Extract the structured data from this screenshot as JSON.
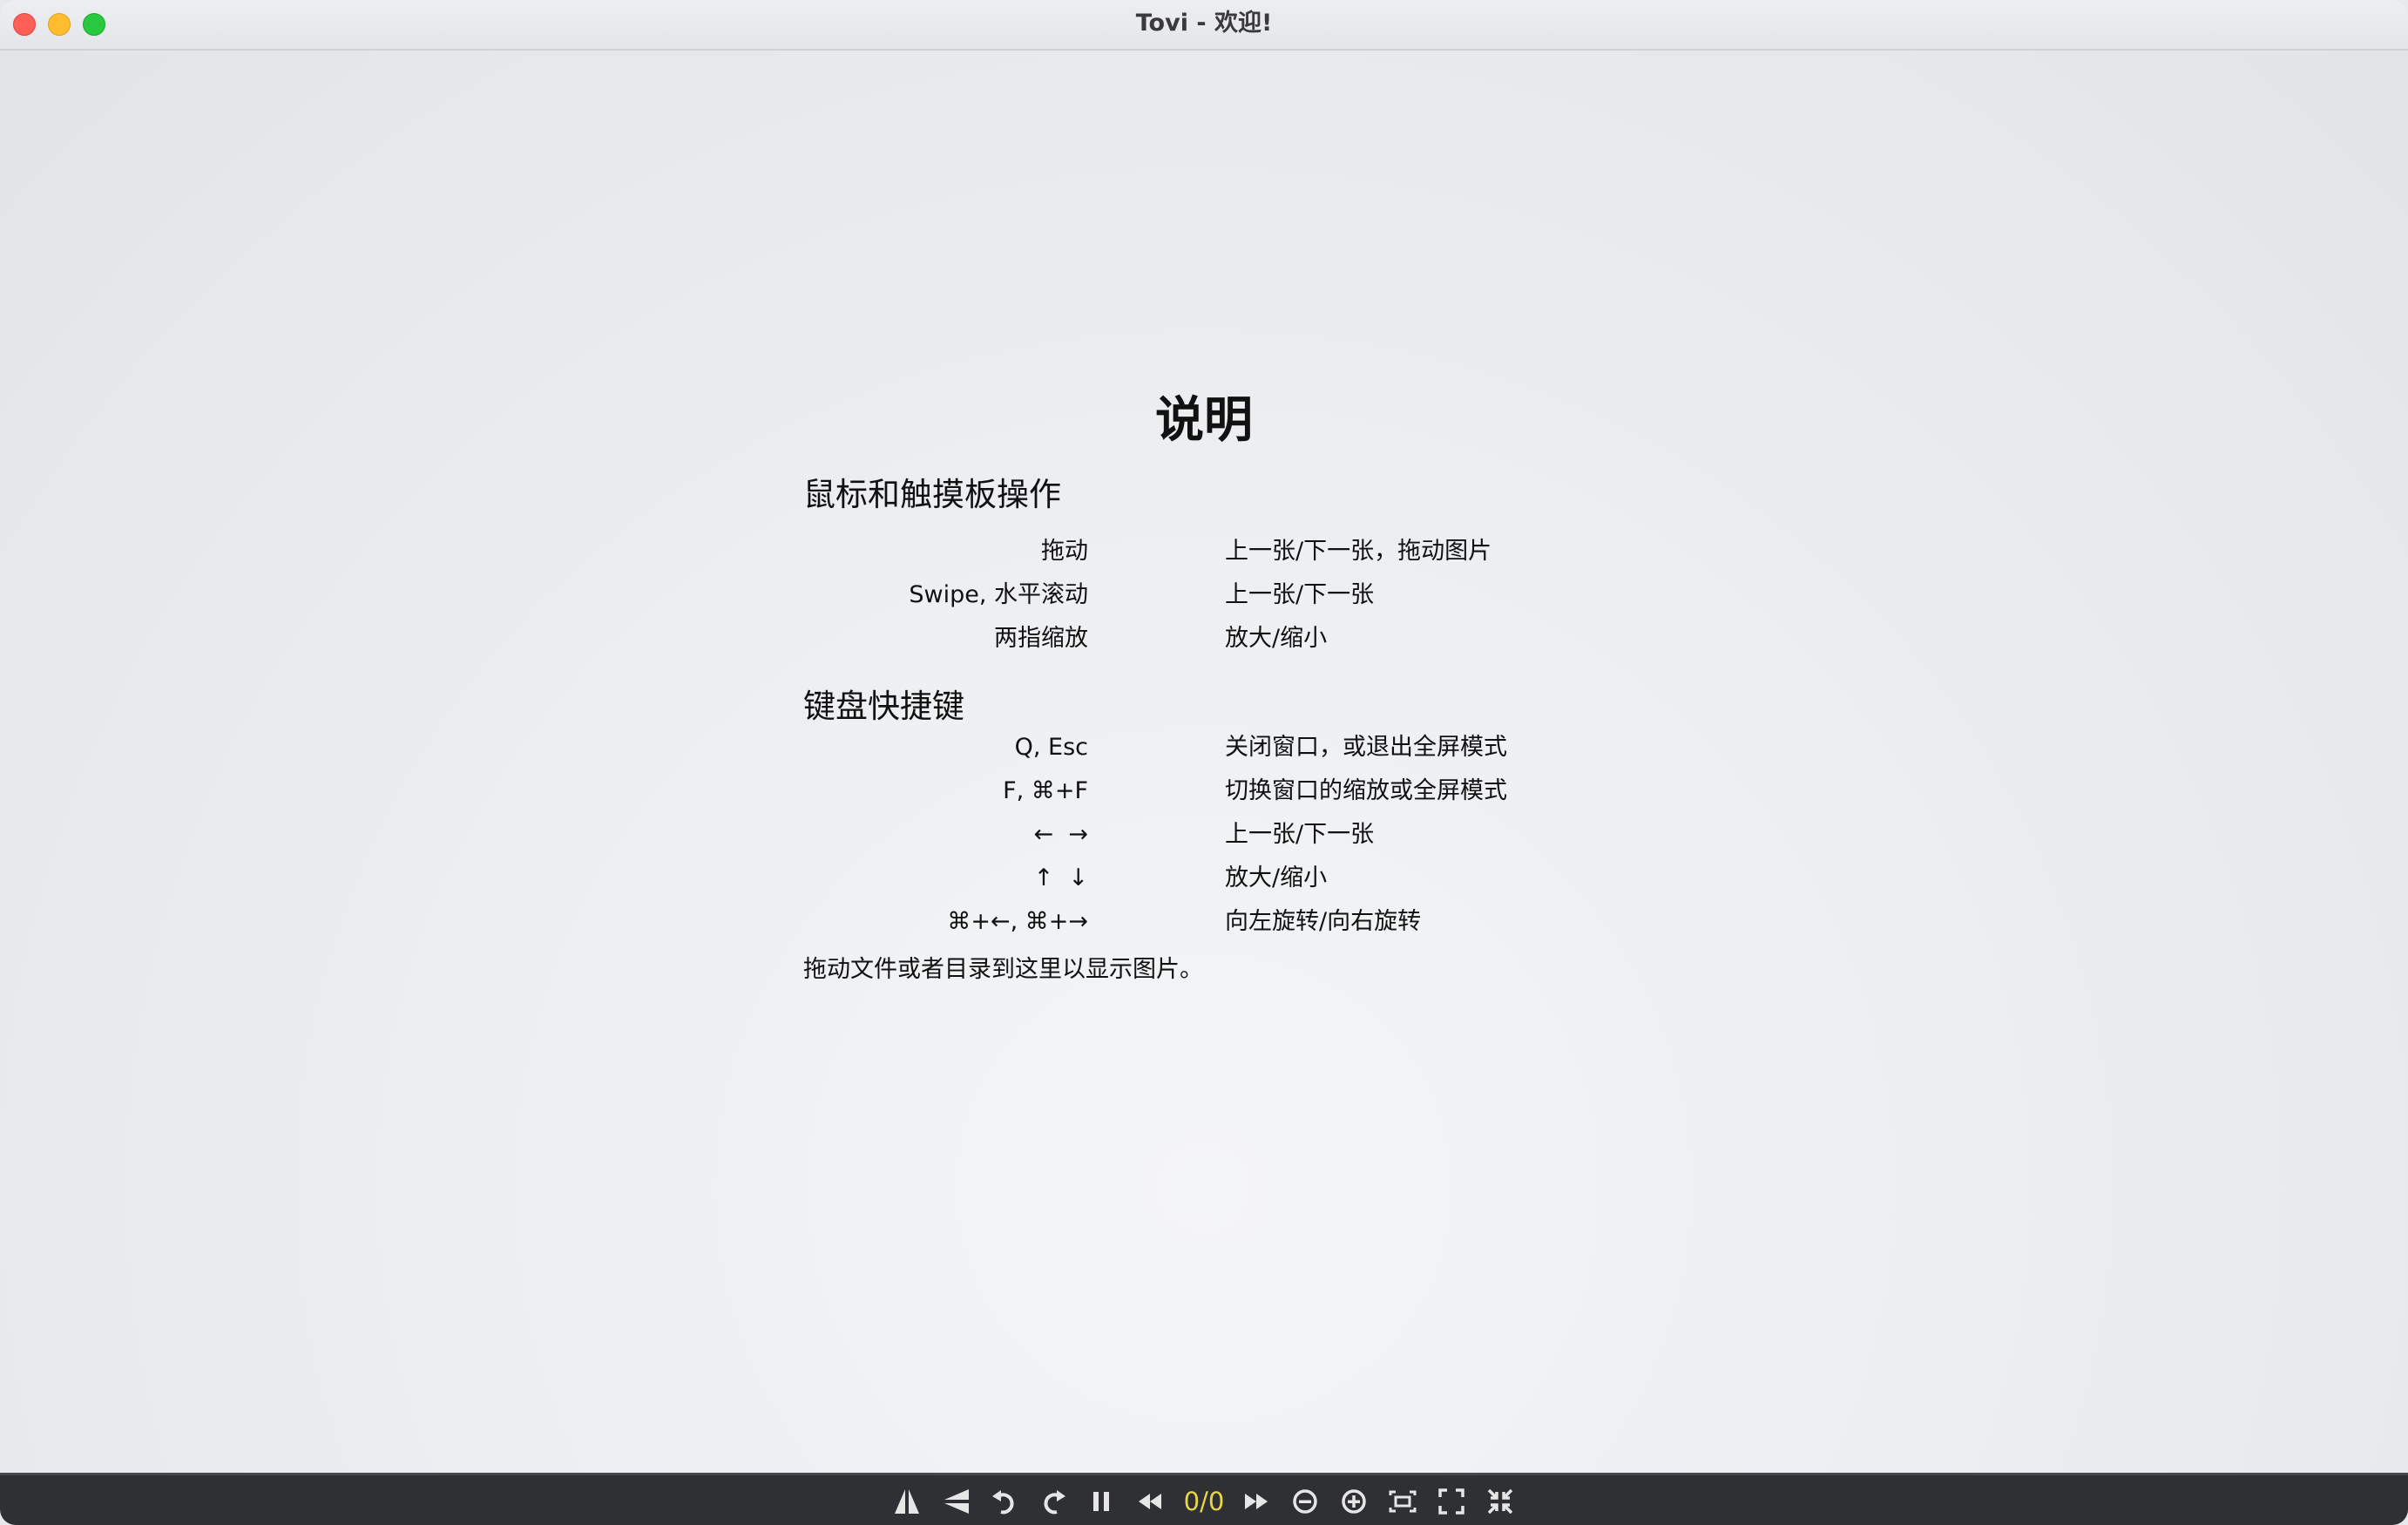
{
  "window": {
    "title": "Tovi - 欢迎!"
  },
  "doc": {
    "title": "说明",
    "mouse_section": {
      "heading": "鼠标和触摸板操作",
      "rows": [
        {
          "key": "拖动",
          "desc": "上一张/下一张，拖动图片"
        },
        {
          "key": "Swipe, 水平滚动",
          "desc": "上一张/下一张"
        },
        {
          "key": "两指缩放",
          "desc": "放大/缩小"
        }
      ]
    },
    "keyboard_section": {
      "heading": "键盘快捷键",
      "rows": [
        {
          "key": "Q, Esc",
          "desc": "关闭窗口，或退出全屏模式"
        },
        {
          "key": "F, ⌘+F",
          "desc": "切换窗口的缩放或全屏模式"
        },
        {
          "key": "←  →",
          "desc": "上一张/下一张"
        },
        {
          "key": "↑  ↓",
          "desc": "放大/缩小"
        },
        {
          "key": "⌘+←, ⌘+→",
          "desc": "向左旋转/向右旋转"
        }
      ]
    },
    "footer_note": "拖动文件或者目录到这里以显示图片。"
  },
  "toolbar": {
    "counter": "0/0",
    "counter_color": "#e8d64a",
    "icons": [
      "flip-horizontal-icon",
      "flip-vertical-icon",
      "rotate-left-icon",
      "rotate-right-icon",
      "pause-icon",
      "previous-icon",
      "next-icon",
      "zoom-out-icon",
      "zoom-in-icon",
      "fit-window-icon",
      "fullscreen-icon",
      "exit-fullscreen-icon"
    ]
  }
}
